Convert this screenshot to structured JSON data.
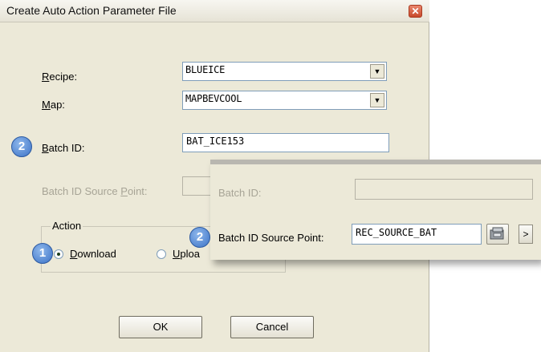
{
  "dialog": {
    "title": "Create Auto Action Parameter File",
    "close_glyph": "✕",
    "recipe": {
      "label_prefix": "",
      "label_mnemonic": "R",
      "label_rest": "ecipe:",
      "value": "BLUEICE"
    },
    "map": {
      "label_mnemonic": "M",
      "label_rest": "ap:",
      "value": "MAPBEVCOOL"
    },
    "batch_id": {
      "label_mnemonic": "B",
      "label_rest": "atch ID:",
      "value": "BAT_ICE153",
      "badge": "2"
    },
    "batch_source": {
      "label_prefix": "Batch ID Source ",
      "label_mnemonic": "P",
      "label_rest": "oint:"
    },
    "action": {
      "group_label": "Action",
      "badge": "1",
      "download": {
        "label_mnemonic": "D",
        "label_rest": "ownload",
        "selected": true
      },
      "upload": {
        "label_mnemonic": "U",
        "label_rest": "ploa"
      }
    },
    "buttons": {
      "ok": "OK",
      "cancel": "Cancel"
    }
  },
  "overlay": {
    "batch_id_label": "Batch ID:",
    "batch_source_label": "Batch ID Source Point:",
    "batch_source_value": "REC_SOURCE_BAT",
    "badge": "2",
    "picker_icon": "picker-icon",
    "next_glyph": ">"
  },
  "dropdown_glyph": "▼"
}
